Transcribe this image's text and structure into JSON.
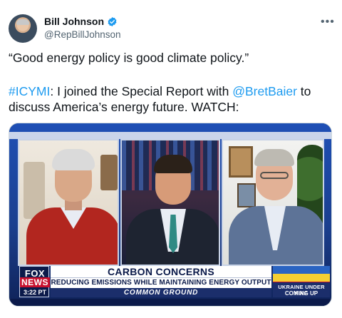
{
  "author": {
    "name": "Bill Johnson",
    "handle": "@RepBillJohnson",
    "verified": true
  },
  "more_icon": "more-horizontal-icon",
  "tweet": {
    "quote": "“Good energy policy is good climate policy.”",
    "hashtag": "#ICYMI",
    "body_1": ": I joined the Special Report with ",
    "mention": "@BretBaier",
    "body_2": " to discuss America’s energy future. WATCH:"
  },
  "video": {
    "network_top": "FOX",
    "network_bottom": "NEWS",
    "time": "3:22 PT",
    "headline": "CARBON CONCERNS",
    "subheadline": "REDUCING EMISSIONS WHILE MAINTAINING ENERGY OUTPUT",
    "segment": "COMMON GROUND",
    "side_line1": "UKRAINE UNDER FIRE",
    "side_line2": "COMING UP"
  },
  "colors": {
    "link": "#1d9bf0",
    "fox_red": "#c8102e",
    "fox_navy": "#0b1a4a"
  }
}
